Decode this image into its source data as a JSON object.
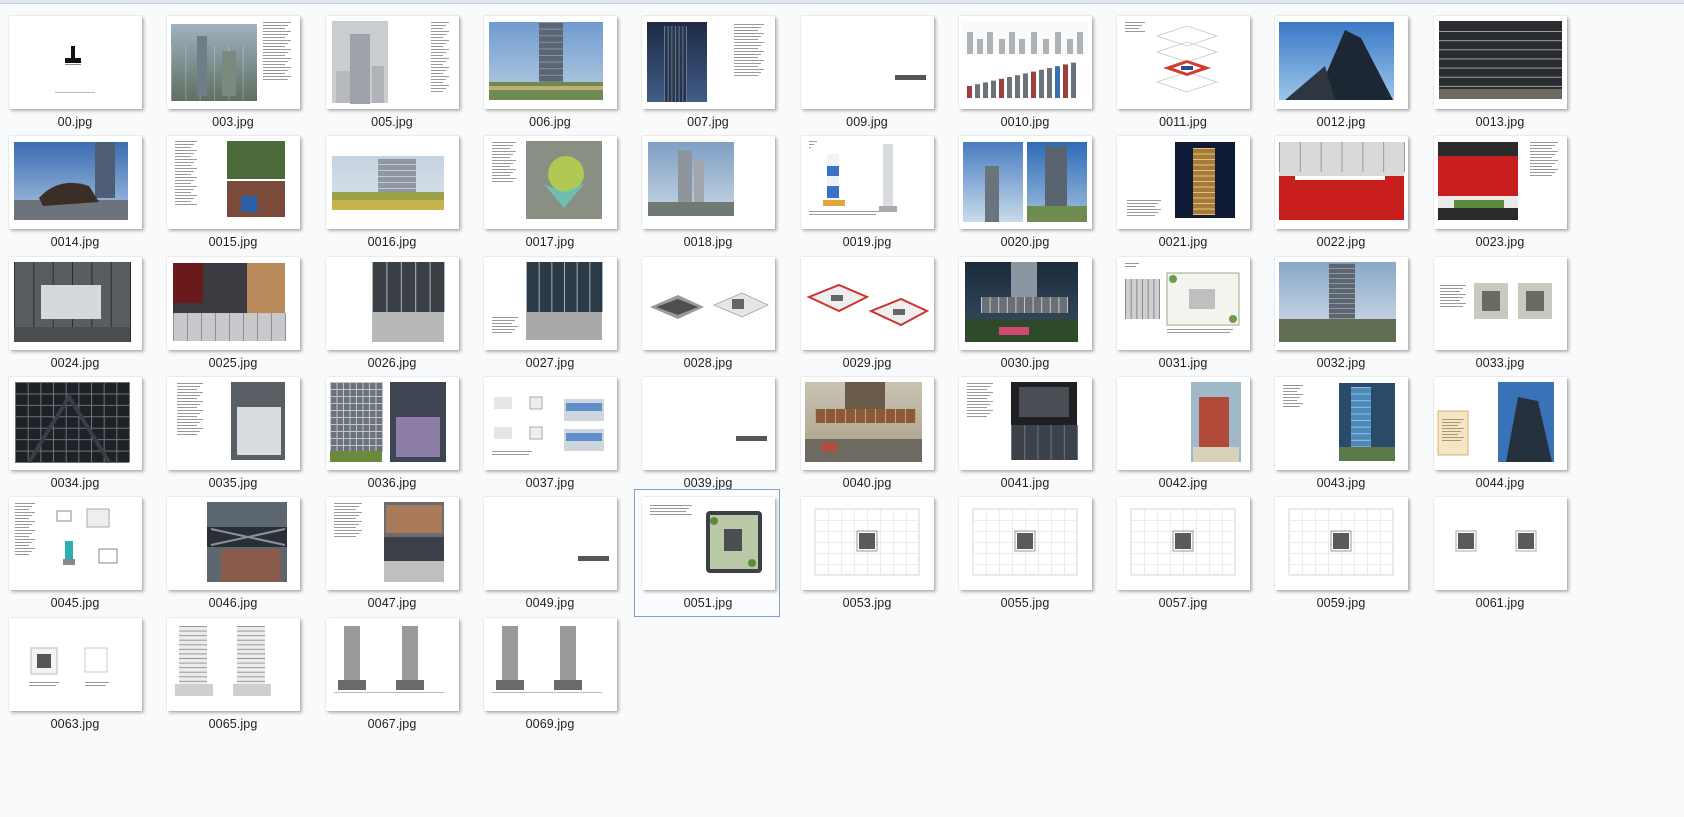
{
  "files": [
    {
      "name": "00.jpg",
      "variant": "logo"
    },
    {
      "name": "003.jpg",
      "variant": "aerial-text"
    },
    {
      "name": "005.jpg",
      "variant": "tower-text"
    },
    {
      "name": "006.jpg",
      "variant": "tower-photo"
    },
    {
      "name": "007.jpg",
      "variant": "dark-tower-text"
    },
    {
      "name": "009.jpg",
      "variant": "blank-bar"
    },
    {
      "name": "0010.jpg",
      "variant": "skyline-bars"
    },
    {
      "name": "0011.jpg",
      "variant": "axon-red"
    },
    {
      "name": "0012.jpg",
      "variant": "sky-tower"
    },
    {
      "name": "0013.jpg",
      "variant": "facade"
    },
    {
      "name": "0014.jpg",
      "variant": "bull"
    },
    {
      "name": "0015.jpg",
      "variant": "text-collage"
    },
    {
      "name": "0016.jpg",
      "variant": "green-field"
    },
    {
      "name": "0017.jpg",
      "variant": "green-map"
    },
    {
      "name": "0018.jpg",
      "variant": "city-tower"
    },
    {
      "name": "0019.jpg",
      "variant": "section-blue"
    },
    {
      "name": "0020.jpg",
      "variant": "double-tower"
    },
    {
      "name": "0021.jpg",
      "variant": "night-tower"
    },
    {
      "name": "0022.jpg",
      "variant": "red-stairs"
    },
    {
      "name": "0023.jpg",
      "variant": "red-text"
    },
    {
      "name": "0024.jpg",
      "variant": "grey-hall"
    },
    {
      "name": "0025.jpg",
      "variant": "lobby"
    },
    {
      "name": "0026.jpg",
      "variant": "interior-right"
    },
    {
      "name": "0027.jpg",
      "variant": "interior-text"
    },
    {
      "name": "0028.jpg",
      "variant": "axon-grey"
    },
    {
      "name": "0029.jpg",
      "variant": "axon-red2"
    },
    {
      "name": "0030.jpg",
      "variant": "render-podium"
    },
    {
      "name": "0031.jpg",
      "variant": "plan-green"
    },
    {
      "name": "0032.jpg",
      "variant": "tower-roof"
    },
    {
      "name": "0033.jpg",
      "variant": "two-plans"
    },
    {
      "name": "0034.jpg",
      "variant": "dark-grid"
    },
    {
      "name": "0035.jpg",
      "variant": "text-grey"
    },
    {
      "name": "0036.jpg",
      "variant": "facade-two"
    },
    {
      "name": "0037.jpg",
      "variant": "diagram-blue"
    },
    {
      "name": "0039.jpg",
      "variant": "blank-bar"
    },
    {
      "name": "0040.jpg",
      "variant": "sepia-podium"
    },
    {
      "name": "0041.jpg",
      "variant": "text-dark"
    },
    {
      "name": "0042.jpg",
      "variant": "construction"
    },
    {
      "name": "0043.jpg",
      "variant": "text-tower-blue"
    },
    {
      "name": "0044.jpg",
      "variant": "cert-tower"
    },
    {
      "name": "0045.jpg",
      "variant": "diagrams-teal"
    },
    {
      "name": "0046.jpg",
      "variant": "truss"
    },
    {
      "name": "0047.jpg",
      "variant": "text-photo"
    },
    {
      "name": "0049.jpg",
      "variant": "blank-bar"
    },
    {
      "name": "0051.jpg",
      "variant": "roof-garden",
      "selected": true
    },
    {
      "name": "0053.jpg",
      "variant": "floorplan"
    },
    {
      "name": "0055.jpg",
      "variant": "floorplan"
    },
    {
      "name": "0057.jpg",
      "variant": "floorplan"
    },
    {
      "name": "0059.jpg",
      "variant": "floorplan"
    },
    {
      "name": "0061.jpg",
      "variant": "two-squares"
    },
    {
      "name": "0063.jpg",
      "variant": "square-plan"
    },
    {
      "name": "0065.jpg",
      "variant": "elevation-detail"
    },
    {
      "name": "0067.jpg",
      "variant": "elevation"
    },
    {
      "name": "0069.jpg",
      "variant": "elevation"
    }
  ]
}
